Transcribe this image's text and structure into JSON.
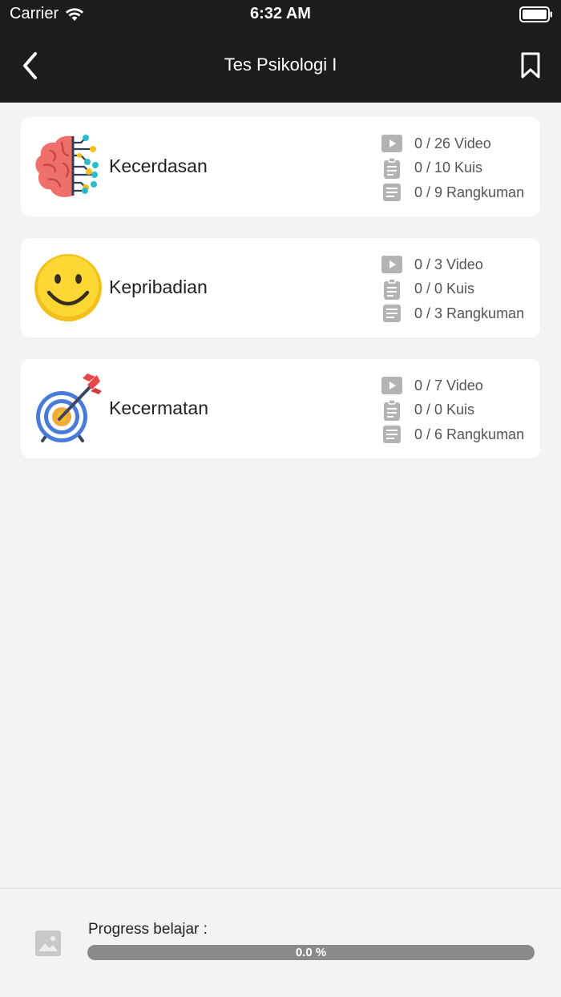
{
  "status_bar": {
    "carrier": "Carrier",
    "time": "6:32 AM",
    "wifi_icon": "wifi-icon",
    "battery_icon": "battery-icon"
  },
  "nav": {
    "title": "Tes Psikologi I",
    "back_icon": "chevron-left-icon",
    "bookmark_icon": "bookmark-icon"
  },
  "categories": [
    {
      "title": "Kecerdasan",
      "icon": "brain-icon",
      "stats": [
        {
          "icon": "play-icon",
          "text": "0 / 26 Video"
        },
        {
          "icon": "clipboard-icon",
          "text": "0 / 10 Kuis"
        },
        {
          "icon": "document-icon",
          "text": "0 / 9 Rangkuman"
        }
      ]
    },
    {
      "title": "Kepribadian",
      "icon": "smiley-icon",
      "stats": [
        {
          "icon": "play-icon",
          "text": "0 / 3 Video"
        },
        {
          "icon": "clipboard-icon",
          "text": "0 / 0 Kuis"
        },
        {
          "icon": "document-icon",
          "text": "0 / 3 Rangkuman"
        }
      ]
    },
    {
      "title": "Kecermatan",
      "icon": "target-icon",
      "stats": [
        {
          "icon": "play-icon",
          "text": "0 / 7 Video"
        },
        {
          "icon": "clipboard-icon",
          "text": "0 / 0 Kuis"
        },
        {
          "icon": "document-icon",
          "text": "0 / 6 Rangkuman"
        }
      ]
    }
  ],
  "progress": {
    "label": "Progress belajar :",
    "value_text": "0.0 %",
    "percent": 0,
    "image_icon": "image-placeholder-icon"
  },
  "colors": {
    "header": "#1e1c1b",
    "background": "#f3f3f3",
    "card": "#ffffff",
    "progress_track": "#8a8a8a",
    "stat_icon": "#b3b3b3"
  }
}
